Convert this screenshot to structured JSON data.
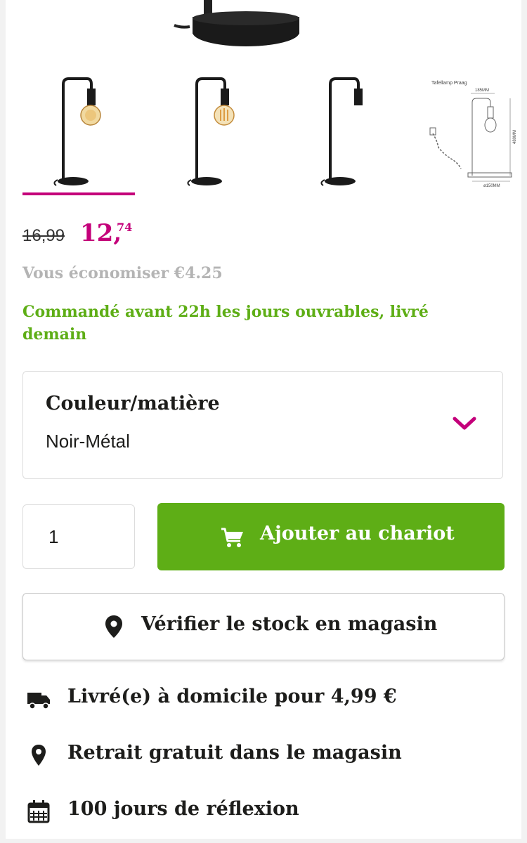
{
  "colors": {
    "accent": "#c4007a",
    "primary_green": "#5eae16",
    "muted_text": "#b4b4b4",
    "border": "#dcdcdc"
  },
  "gallery": {
    "thumbnails": [
      {
        "name": "lamp-lit-globe",
        "selected": true
      },
      {
        "name": "lamp-lit-filament",
        "selected": false
      },
      {
        "name": "lamp-no-bulb",
        "selected": false
      },
      {
        "name": "lamp-dimensions-drawing",
        "selected": false
      }
    ],
    "drawing": {
      "title": "Tafellamp Praag",
      "width_label": "185MM",
      "height_label": "480MM",
      "base_label": "ø150MM"
    }
  },
  "price": {
    "old": "16,99",
    "new_main": "12,",
    "new_cents": "74"
  },
  "savings": "Vous économiser €4.25",
  "delivery_note": "Commandé avant 22h les jours ouvrables, livré demain",
  "variant": {
    "label": "Couleur/matière",
    "value": "Noir-Métal",
    "icon": "chevron-down-icon"
  },
  "quantity": {
    "value": "1"
  },
  "add_to_cart": {
    "label": "Ajouter au chariot",
    "icon": "cart-icon"
  },
  "stock_check": {
    "label": "Vérifier le stock en magasin",
    "icon": "map-pin-icon"
  },
  "usps": [
    {
      "icon": "truck-icon",
      "text": "Livré(e) à domicile pour 4,99 €"
    },
    {
      "icon": "map-pin-icon",
      "text": "Retrait gratuit dans le magasin"
    },
    {
      "icon": "calendar-icon",
      "text": "100 jours de réflexion"
    }
  ]
}
